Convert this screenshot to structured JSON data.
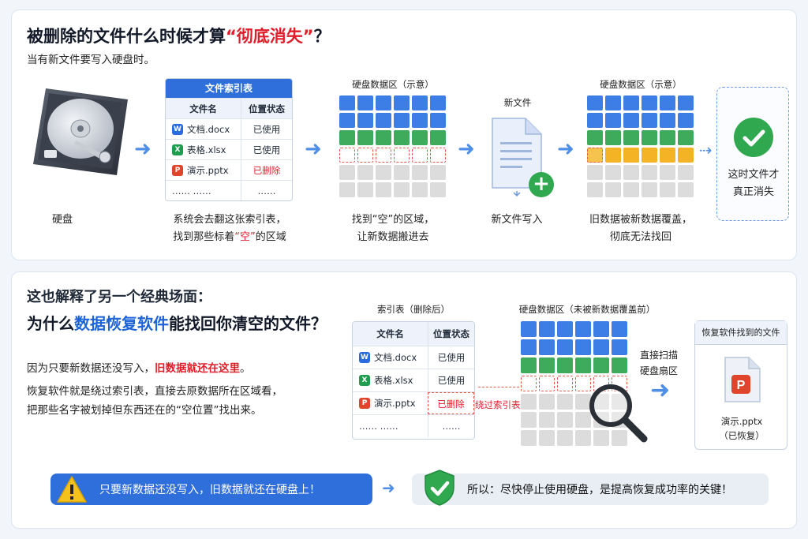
{
  "top": {
    "title_part1": "被删除的文件什么时候才算",
    "title_highlight": "“彻底消失”",
    "title_end": "？",
    "subtitle": "当有新文件要写入硬盘时。",
    "hdd_caption": "硬盘",
    "index_table": {
      "title": "文件索引表",
      "col_name": "文件名",
      "col_status": "位置状态",
      "rows": [
        {
          "icon": "W",
          "name": "文档.docx",
          "status": "已使用"
        },
        {
          "icon": "X",
          "name": "表格.xlsx",
          "status": "已使用"
        },
        {
          "icon": "P",
          "name": "演示.pptx",
          "status": "已删除"
        },
        {
          "icon": "",
          "name": "……  ……",
          "status": "……"
        }
      ]
    },
    "index_caption_line1": "系统会去翻这张索引表，",
    "index_caption_line2_a": "找到那些标着",
    "index_caption_line2_b": "“空”",
    "index_caption_line2_c": "的区域",
    "grid1_label": "硬盘数据区（示意）",
    "grid1_caption_line1": "找到“空”的区域，",
    "grid1_caption_line2": "让新数据搬进去",
    "newfile_label": "新文件",
    "newfile_caption": "新文件写入",
    "grid2_label": "硬盘数据区（示意）",
    "grid2_caption_line1": "旧数据被新数据覆盖，",
    "grid2_caption_line2": "彻底无法找回",
    "final_line1": "这时文件才",
    "final_line2": "真正消失"
  },
  "bottom": {
    "title_line1": "这也解释了另一个经典场面：",
    "title_line2_a": "为什么",
    "title_line2_b": "数据恢复软件",
    "title_line2_c": "能找回你清空的文件？",
    "para1_a": "因为只要新数据还没写入，",
    "para1_b": "旧数据就还在这里",
    "para1_c": "。",
    "para2_line1": "恢复软件就是绕过索引表，直接去原数据所在区域看，",
    "para2_line2": "把那些名字被划掉但东西还在的“空位置”找出来。",
    "index_table": {
      "label": "索引表（删除后）",
      "col_name": "文件名",
      "col_status": "位置状态",
      "rows": [
        {
          "icon": "W",
          "name": "文档.docx",
          "status": "已使用"
        },
        {
          "icon": "X",
          "name": "表格.xlsx",
          "status": "已使用"
        },
        {
          "icon": "P",
          "name": "演示.pptx",
          "status": "已删除"
        },
        {
          "icon": "",
          "name": "……  ……",
          "status": "……"
        }
      ]
    },
    "bypass_label": "绕过索引表",
    "grid_label": "硬盘数据区（未被新数据覆盖前）",
    "scan_label_line1": "直接扫描",
    "scan_label_line2": "硬盘扇区",
    "recovery_title": "恢复软件找到的文件",
    "recovered_name": "演示.pptx",
    "recovered_status": "（已恢复）",
    "warning_text": "只要新数据还没写入，旧数据就还在硬盘上！",
    "tip_text": "所以：尽快停止使用硬盘，是提高恢复成功率的关键！"
  },
  "colors": {
    "accent_blue": "#2f6fdb",
    "highlight_red": "#e11d2a",
    "used_blue": "#3d7de6",
    "used_green": "#3daa5c",
    "new_yellow": "#f3b324",
    "empty_gray": "#dcdcdc",
    "success_green": "#2fa84f"
  },
  "icons": [
    "hard-drive-icon",
    "word-file-icon",
    "excel-file-icon",
    "powerpoint-file-icon",
    "new-document-icon",
    "plus-icon",
    "check-circle-icon",
    "magnifier-icon",
    "warning-icon",
    "shield-check-icon",
    "arrow-right-icon"
  ]
}
